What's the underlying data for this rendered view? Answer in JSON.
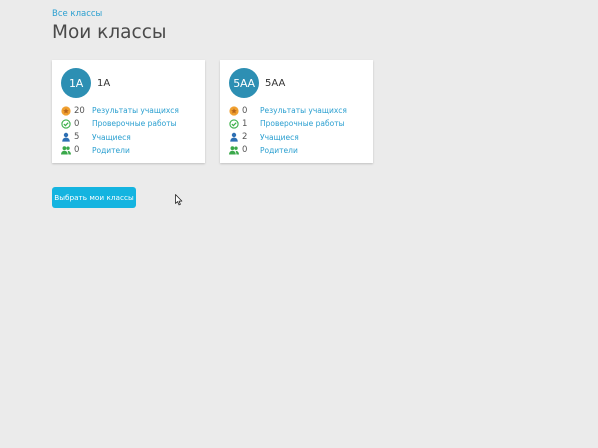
{
  "breadcrumb": "Все классы",
  "page_title": "Мои классы",
  "classes": [
    {
      "badge": "1A",
      "name": "1A",
      "stats": [
        {
          "icon": "medal-icon",
          "count": "20",
          "label": "Результаты учащихся"
        },
        {
          "icon": "check-circle-icon",
          "count": "0",
          "label": "Проверочные работы"
        },
        {
          "icon": "user-icon",
          "count": "5",
          "label": "Учащиеся"
        },
        {
          "icon": "users-icon",
          "count": "0",
          "label": "Родители"
        }
      ]
    },
    {
      "badge": "5AA",
      "name": "5AA",
      "stats": [
        {
          "icon": "medal-icon",
          "count": "0",
          "label": "Результаты учащихся"
        },
        {
          "icon": "check-circle-icon",
          "count": "1",
          "label": "Проверочные работы"
        },
        {
          "icon": "user-icon",
          "count": "2",
          "label": "Учащиеся"
        },
        {
          "icon": "users-icon",
          "count": "0",
          "label": "Родители"
        }
      ]
    }
  ],
  "select_button": "Выбрать мои классы",
  "colors": {
    "accent": "#14b4e0",
    "link": "#2a9fd0",
    "avatar": "#2d8fb3",
    "medal": "#f0a030",
    "check": "#3cb04a",
    "user": "#2d6fb3",
    "parents": "#3aa84a"
  }
}
